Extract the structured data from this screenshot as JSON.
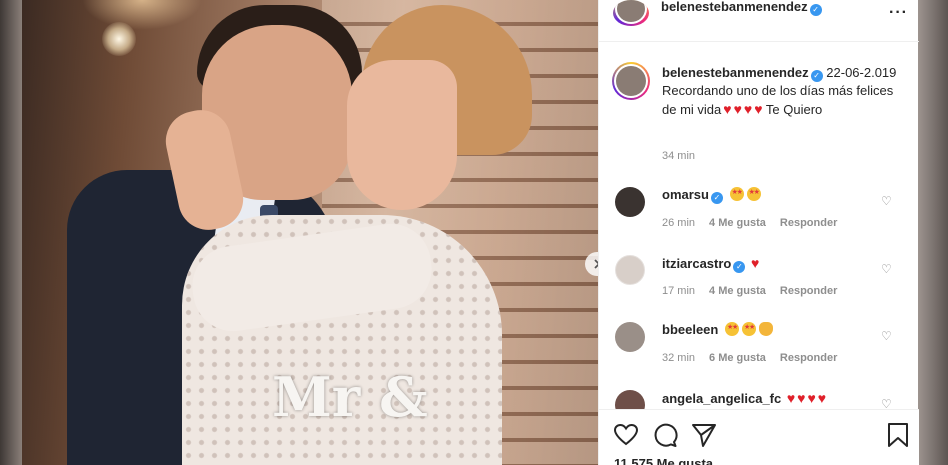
{
  "post": {
    "username": "belenestebanmenendez",
    "caption": "22-06-2.019 Recordando uno de los días más felices de mi vida",
    "caption_suffix": "Te Quiero",
    "time": "34 min",
    "likes": "11.575 Me gusta",
    "image_topper_text": "Mr &"
  },
  "comments": [
    {
      "username": "omarsu",
      "verified": true,
      "emojis": [
        "star-struck",
        "star-struck"
      ],
      "time": "26 min",
      "likes": "4 Me gusta",
      "reply": "Responder"
    },
    {
      "username": "itziarcastro",
      "verified": true,
      "emojis": [
        "red-heart"
      ],
      "time": "17 min",
      "likes": "4 Me gusta",
      "reply": "Responder"
    },
    {
      "username": "bbeeleen",
      "verified": false,
      "emojis": [
        "star-struck",
        "star-struck",
        "clapping-hands"
      ],
      "time": "32 min",
      "likes": "6 Me gusta",
      "reply": "Responder"
    },
    {
      "username": "angela_angelica_fc",
      "verified": false,
      "emojis": [
        "red-heart",
        "red-heart",
        "red-heart",
        "red-heart"
      ]
    }
  ],
  "colors": {
    "verified": "#3897f0",
    "heart": "#e0202a",
    "text": "#262626",
    "muted": "#8e8e8e"
  }
}
